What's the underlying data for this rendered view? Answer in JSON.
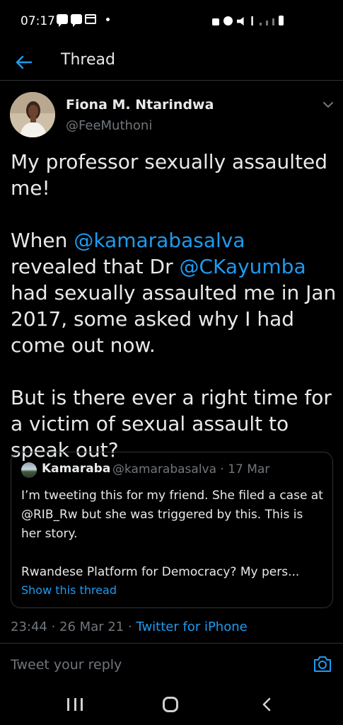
{
  "status_bar": {
    "time": "07:17"
  },
  "header": {
    "title": "Thread"
  },
  "tweet": {
    "author_name": "Fiona M. Ntarindwa",
    "author_handle": "@FeeMuthoni",
    "paragraph1": "My professor sexually assaulted me!",
    "p2_part1": "When ",
    "p2_mention1": "@kamarabasalva",
    "p2_part2": " revealed that Dr ",
    "p2_mention2": "@CKayumba",
    "p2_part3": " had sexually assaulted me in Jan 2017, some asked why I had come out now.",
    "paragraph3": "But is there ever a right time for a victim of sexual assault to speak out?"
  },
  "quote": {
    "name": "Kamaraba",
    "handle_date": "@kamarabasalva · 17 Mar",
    "text1": "I’m tweeting this for my friend. She filed a case at @RIB_Rw but she was triggered by this. This is her story.",
    "text2": "Rwandese Platform for Democracy? My pers...",
    "show_thread": "Show this thread"
  },
  "meta": {
    "timestamp": "23:44 · 26 Mar 21 · ",
    "source": "Twitter for iPhone"
  },
  "reply": {
    "placeholder": "Tweet your reply"
  },
  "colors": {
    "background": "#000000",
    "accent": "#1d9bf0",
    "secondary_text": "#71767b",
    "divider": "#2f3336"
  }
}
